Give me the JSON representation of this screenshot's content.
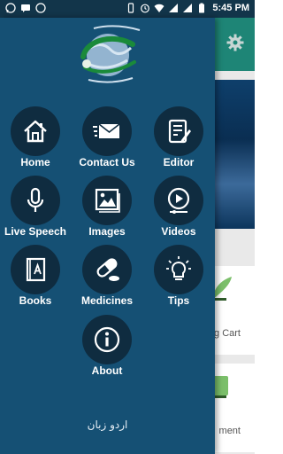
{
  "status_bar": {
    "time": "5:45",
    "period": "PM"
  },
  "drawer": {
    "menu": [
      {
        "label": "Home",
        "icon": "home-icon"
      },
      {
        "label": "Contact Us",
        "icon": "mail-icon"
      },
      {
        "label": "Editor",
        "icon": "note-icon"
      },
      {
        "label": "Live Speech",
        "icon": "microphone-icon"
      },
      {
        "label": "Images",
        "icon": "image-icon"
      },
      {
        "label": "Videos",
        "icon": "play-icon"
      },
      {
        "label": "Books",
        "icon": "book-icon"
      },
      {
        "label": "Medicines",
        "icon": "capsule-icon"
      },
      {
        "label": "Tips",
        "icon": "lightbulb-icon"
      },
      {
        "label": "About",
        "icon": "info-icon"
      }
    ],
    "language_link": "اردو زبان"
  },
  "background_app": {
    "card1_text": "g Cart",
    "card2_text": "ment"
  },
  "colors": {
    "drawer": "#155074",
    "icon_circle": "#0f2c40",
    "toolbar": "#1e8576",
    "status_bar": "#12354a"
  }
}
